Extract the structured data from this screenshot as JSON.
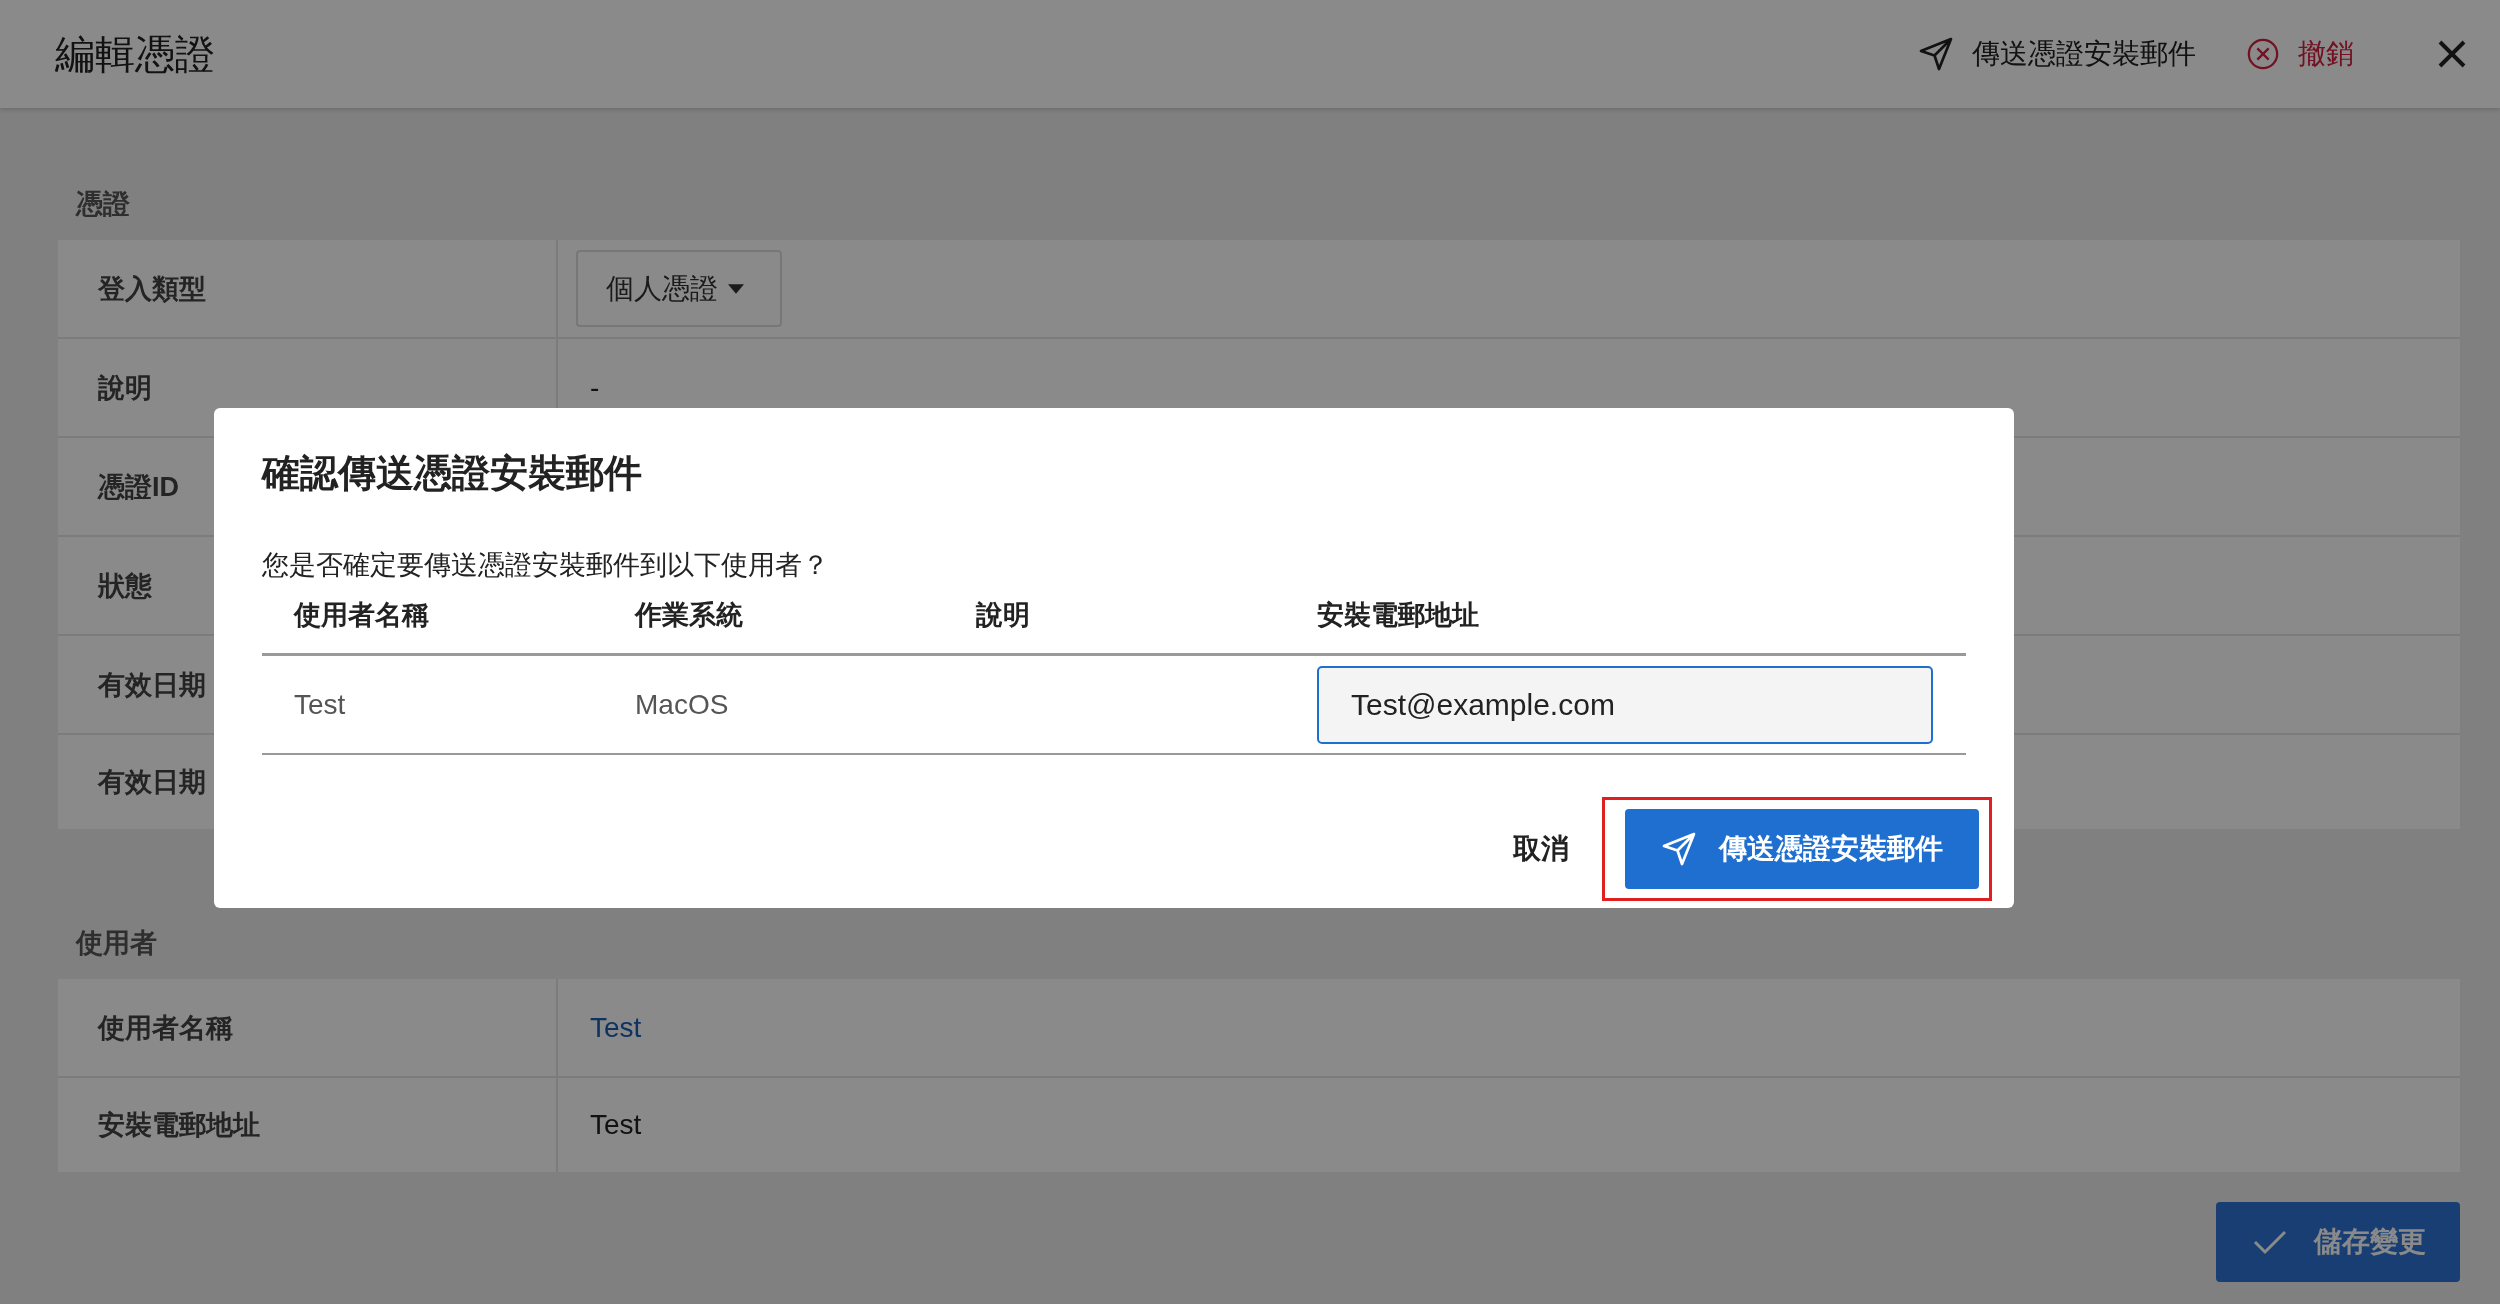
{
  "header": {
    "title": "編輯憑證",
    "actions": [
      {
        "kind": "send",
        "label": "傳送憑證安裝郵件"
      },
      {
        "kind": "revoke",
        "label": "撤銷"
      },
      {
        "kind": "close"
      }
    ]
  },
  "sections": [
    {
      "title": "憑證",
      "rows": [
        {
          "label": "登入類型",
          "kind": "dropdown",
          "value": "個人憑證"
        },
        {
          "label": "說明",
          "kind": "text",
          "value": "-"
        },
        {
          "label": "憑證ID"
        },
        {
          "label": "狀態"
        },
        {
          "label": "有效日期"
        },
        {
          "label": "有效日期"
        }
      ]
    },
    {
      "title": "使用者",
      "rows": [
        {
          "label": "使用者名稱",
          "kind": "link",
          "value": "Test"
        },
        {
          "label": "安裝電郵地址",
          "kind": "text",
          "value": "Test"
        }
      ]
    }
  ],
  "save_button": {
    "label": "儲存變更"
  },
  "dialog": {
    "title": "確認傳送憑證安裝郵件",
    "message": "您是否確定要傳送憑證安裝郵件到以下使用者？",
    "columns": [
      "使用者名稱",
      "作業系統",
      "說明",
      "安裝電郵地址"
    ],
    "rows": [
      {
        "user": "Test",
        "os": "MacOS",
        "email": "Test@example.com"
      }
    ],
    "buttons": [
      {
        "kind": "cancel",
        "label": "取消",
        "highlighted": false
      },
      {
        "kind": "send",
        "label": "傳送憑證安裝郵件",
        "highlighted": true
      }
    ]
  }
}
